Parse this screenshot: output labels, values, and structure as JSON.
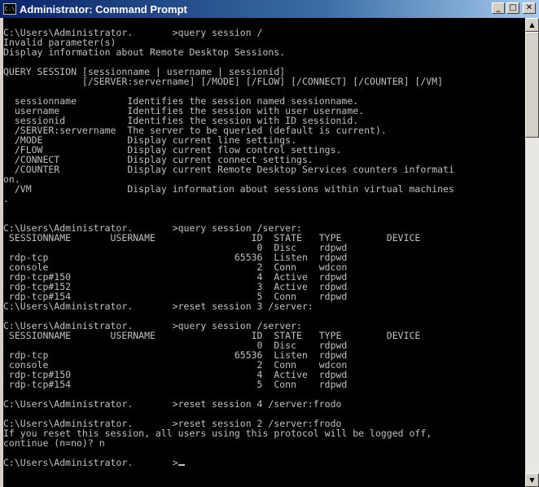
{
  "window": {
    "title": "Administrator: Command Prompt",
    "icon_label": "C:\\",
    "icon": "cmd-icon",
    "minimize_glyph": "_",
    "maximize_glyph": "□",
    "close_glyph": "✕"
  },
  "colors": {
    "title_gradient_start": "#0a246a",
    "title_gradient_end": "#a6caf0",
    "console_bg": "#000000",
    "console_fg": "#c0c0c0"
  },
  "console": {
    "lines": [
      "C:\\Users\\Administrator.       >query session /    ",
      "Invalid parameter(s)",
      "Display information about Remote Desktop Sessions.",
      "",
      "QUERY SESSION [sessionname | username | sessionid]",
      "              [/SERVER:servername] [/MODE] [/FLOW] [/CONNECT] [/COUNTER] [/VM]",
      "",
      "  sessionname         Identifies the session named sessionname.",
      "  username            Identifies the session with user username.",
      "  sessionid           Identifies the session with ID sessionid.",
      "  /SERVER:servername  The server to be queried (default is current).",
      "  /MODE               Display current line settings.",
      "  /FLOW               Display current flow control settings.",
      "  /CONNECT            Display current connect settings.",
      "  /COUNTER            Display current Remote Desktop Services counters informati",
      "on.",
      "  /VM                 Display information about sessions within virtual machines",
      ".",
      "",
      "",
      "C:\\Users\\Administrator.       >query session /server:     ",
      " SESSIONNAME       USERNAME                 ID  STATE   TYPE        DEVICE",
      "                                             0  Disc    rdpwd",
      " rdp-tcp                                 65536  Listen  rdpwd",
      " console                                     2  Conn    wdcon",
      " rdp-tcp#150                                 4  Active  rdpwd",
      " rdp-tcp#152                                 3  Active  rdpwd",
      " rdp-tcp#154                                 5  Conn    rdpwd",
      "C:\\Users\\Administrator.       >reset session 3 /server:     ",
      "",
      "C:\\Users\\Administrator.       >query session /server:     ",
      " SESSIONNAME       USERNAME                 ID  STATE   TYPE        DEVICE",
      "                                             0  Disc    rdpwd",
      " rdp-tcp                                 65536  Listen  rdpwd",
      " console                                     2  Conn    wdcon",
      " rdp-tcp#150                                 4  Active  rdpwd",
      " rdp-tcp#154                                 5  Conn    rdpwd",
      "",
      "C:\\Users\\Administrator.       >reset session 4 /server:frodo",
      "",
      "C:\\Users\\Administrator.       >reset session 2 /server:frodo",
      "If you reset this session, all users using this protocol will be logged off,",
      "continue (n=no)? n",
      "",
      "C:\\Users\\Administrator.       >"
    ]
  }
}
